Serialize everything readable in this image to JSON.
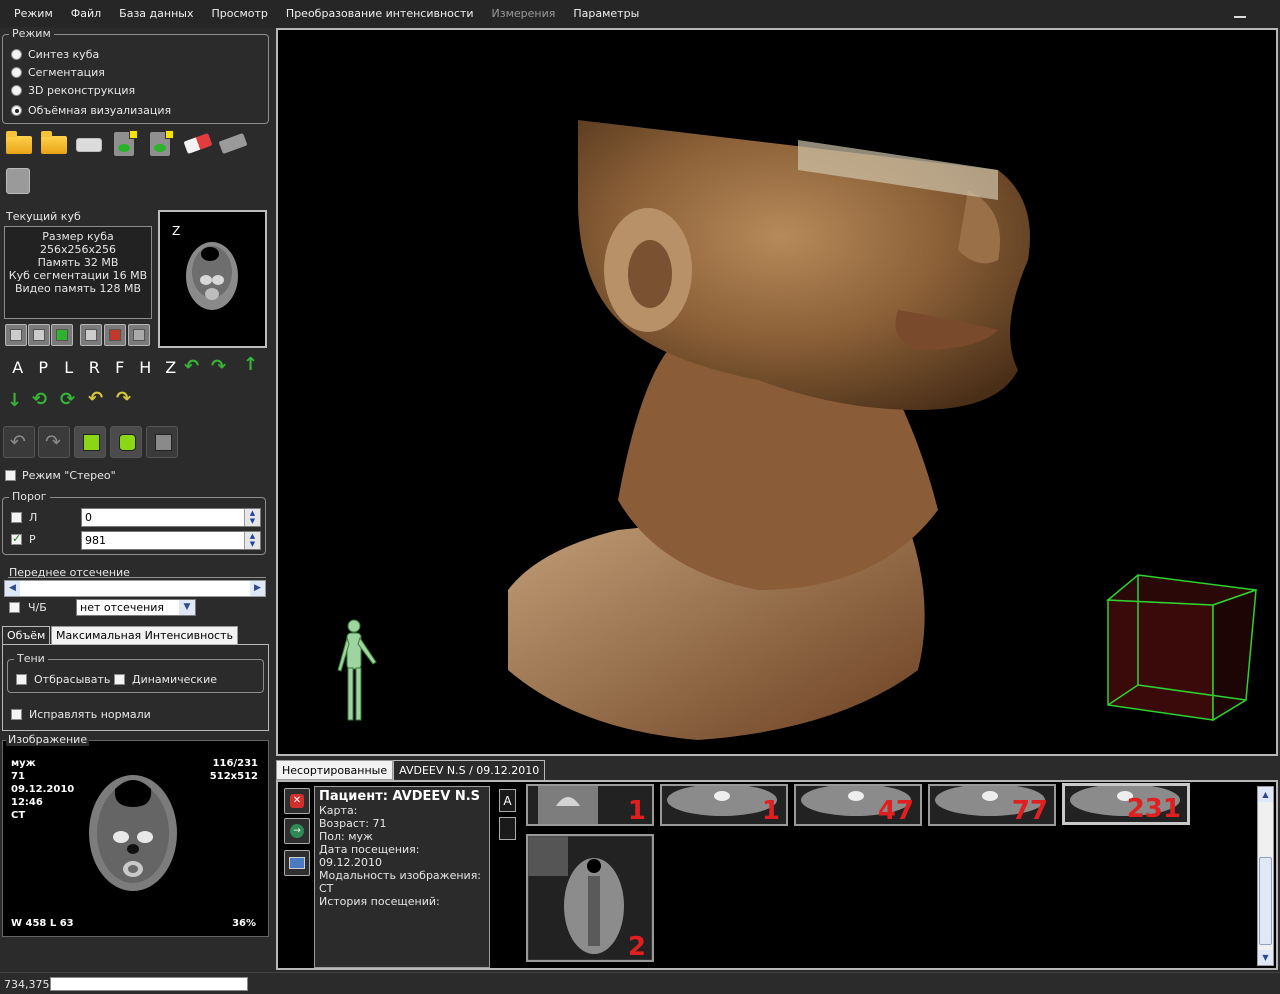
{
  "menu": [
    "Режим",
    "Файл",
    "База данных",
    "Просмотр",
    "Преобразование интенсивности",
    "Измерения",
    "Параметры"
  ],
  "mode_group": {
    "title": "Режим",
    "options": [
      "Синтез куба",
      "Сегментация",
      "3D реконструкция",
      "Объёмная визуализация"
    ],
    "selected": "Объёмная визуализация"
  },
  "current_cube": {
    "title": "Текущий куб",
    "lines": [
      "Размер куба 256x256x256",
      "Память 32 MB",
      "Куб сегментации 16 MB",
      "Видео память 128 MB"
    ],
    "thumb_label": "Z"
  },
  "directions": [
    "A",
    "P",
    "L",
    "R",
    "F",
    "H",
    "Z"
  ],
  "stereo_label": "Режим \"Стерео\"",
  "threshold": {
    "title": "Порог",
    "low_label": "Л",
    "low_value": "0",
    "high_label": "Р",
    "high_value": "981"
  },
  "front_clip": {
    "title": "Переднее отсечение",
    "bw_label": "Ч/Б",
    "combo_value": "нет отсечения"
  },
  "render_tabs": [
    "Объём",
    "Максимальная Интенсивность"
  ],
  "shadows": {
    "title": "Тени",
    "cast_label": "Отбрасывать",
    "dynamic_label": "Динамические",
    "fix_normals_label": "Исправлять нормали"
  },
  "image_panel": {
    "title": "Изображение",
    "sex": "муж",
    "age": "71",
    "date": "09.12.2010",
    "time": "12:46",
    "modality": "CT",
    "slice": "116/231",
    "matrix": "512x512",
    "window": "W 458 L 63",
    "zoom": "36%"
  },
  "browser_tabs": [
    "Несортированные",
    "AVDEEV N.S / 09.12.2010"
  ],
  "patient": {
    "title": "Пациент: AVDEEV N.S",
    "card": "Карта:",
    "age": "Возраст: 71",
    "sex": "Пол: муж",
    "visit_date": "Дата посещения: 09.12.2010",
    "modality": "Модальность изображения: CT",
    "history": "История посещений:"
  },
  "ab_buttons": [
    "A",
    ""
  ],
  "series": [
    "1",
    "1",
    "47",
    "77",
    "231",
    "2"
  ],
  "status": {
    "coords": "734,375"
  },
  "colors": {
    "accent_green": "#37b437",
    "series_number": "#e02020",
    "background": "#2b2b2b"
  }
}
